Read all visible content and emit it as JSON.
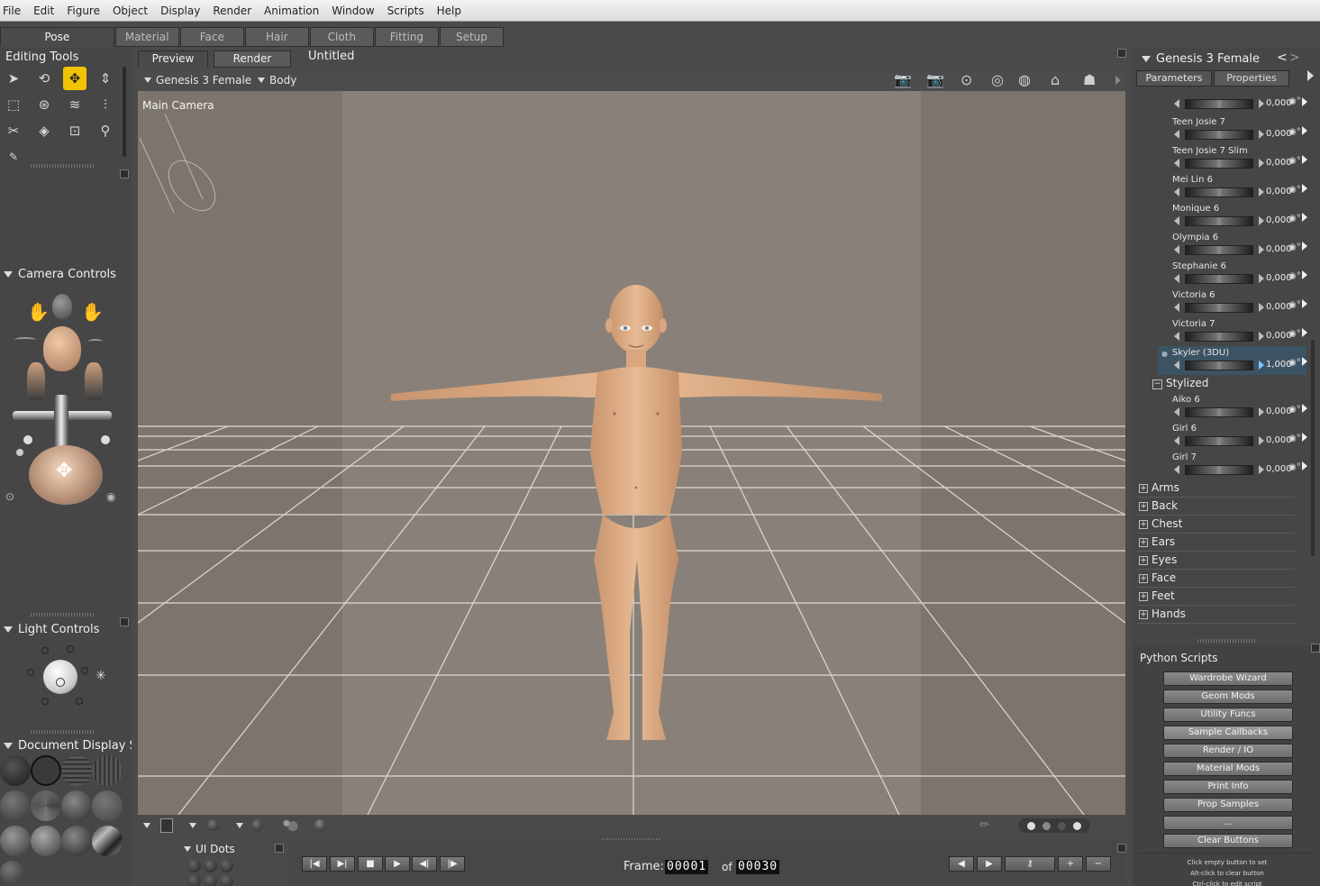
{
  "menubar": [
    "File",
    "Edit",
    "Figure",
    "Object",
    "Display",
    "Render",
    "Animation",
    "Window",
    "Scripts",
    "Help"
  ],
  "rooms": [
    {
      "label": "Pose",
      "active": true
    },
    {
      "label": "Material",
      "active": false
    },
    {
      "label": "Face",
      "active": false
    },
    {
      "label": "Hair",
      "active": false
    },
    {
      "label": "Cloth",
      "active": false
    },
    {
      "label": "Fitting",
      "active": false
    },
    {
      "label": "Setup",
      "active": false
    }
  ],
  "left": {
    "editing_tools": "Editing Tools",
    "tool_icons": [
      "pointer-icon",
      "rotate-icon",
      "translate-icon",
      "scale-vertical-icon",
      "taper-icon",
      "twist-icon",
      "chain-icon",
      "morph-brush-icon",
      "grouping-icon",
      "paint-icon",
      "view-magnify-icon",
      "zoom-icon",
      "eyedropper-icon"
    ],
    "camera_controls": "Camera Controls",
    "light_controls": "Light Controls",
    "document_display": "Document Display S",
    "ui_dots": "UI Dots"
  },
  "viewport": {
    "tabs": [
      "Preview",
      "Render"
    ],
    "document_title": "Untitled",
    "figure_select": "Genesis 3 Female",
    "actor_select": "Body",
    "camera_label": "Main Camera"
  },
  "timeline": {
    "frame_label": "Frame:",
    "frame": "00001",
    "of_label": "of",
    "total": "00030"
  },
  "right": {
    "figure_title": "Genesis 3 Female",
    "tabs": [
      "Parameters",
      "Properties"
    ],
    "first_value": "0,000",
    "params": [
      {
        "label": "Teen Josie 7",
        "value": "0,000"
      },
      {
        "label": "Teen Josie 7 Slim",
        "value": "0,000"
      },
      {
        "label": "Mei Lin 6",
        "value": "0,000"
      },
      {
        "label": "Monique 6",
        "value": "0,000"
      },
      {
        "label": "Olympia 6",
        "value": "0,000"
      },
      {
        "label": "Stephanie 6",
        "value": "0,000"
      },
      {
        "label": "Victoria 6",
        "value": "0,000"
      },
      {
        "label": "Victoria 7",
        "value": "0,000"
      },
      {
        "label": "Skyler (3DU)",
        "value": "1,000",
        "selected": true
      }
    ],
    "stylized_group": "Stylized",
    "stylized_params": [
      {
        "label": "Aiko 6",
        "value": "0,000"
      },
      {
        "label": "Girl 6",
        "value": "0,000"
      },
      {
        "label": "Girl 7",
        "value": "0,000"
      }
    ],
    "categories": [
      "Arms",
      "Back",
      "Chest",
      "Ears",
      "Eyes",
      "Face",
      "Feet",
      "Hands"
    ],
    "python_title": "Python Scripts",
    "python_buttons": [
      "Wardrobe Wizard",
      "Geom Mods",
      "Utility Funcs",
      "Sample Callbacks",
      "Render / IO",
      "Material Mods",
      "Print Info",
      "Prop Samples",
      "...",
      "Clear Buttons"
    ],
    "python_hints": [
      "Click empty button to set",
      "Alt-click to clear button",
      "Ctrl-click to edit script"
    ]
  }
}
